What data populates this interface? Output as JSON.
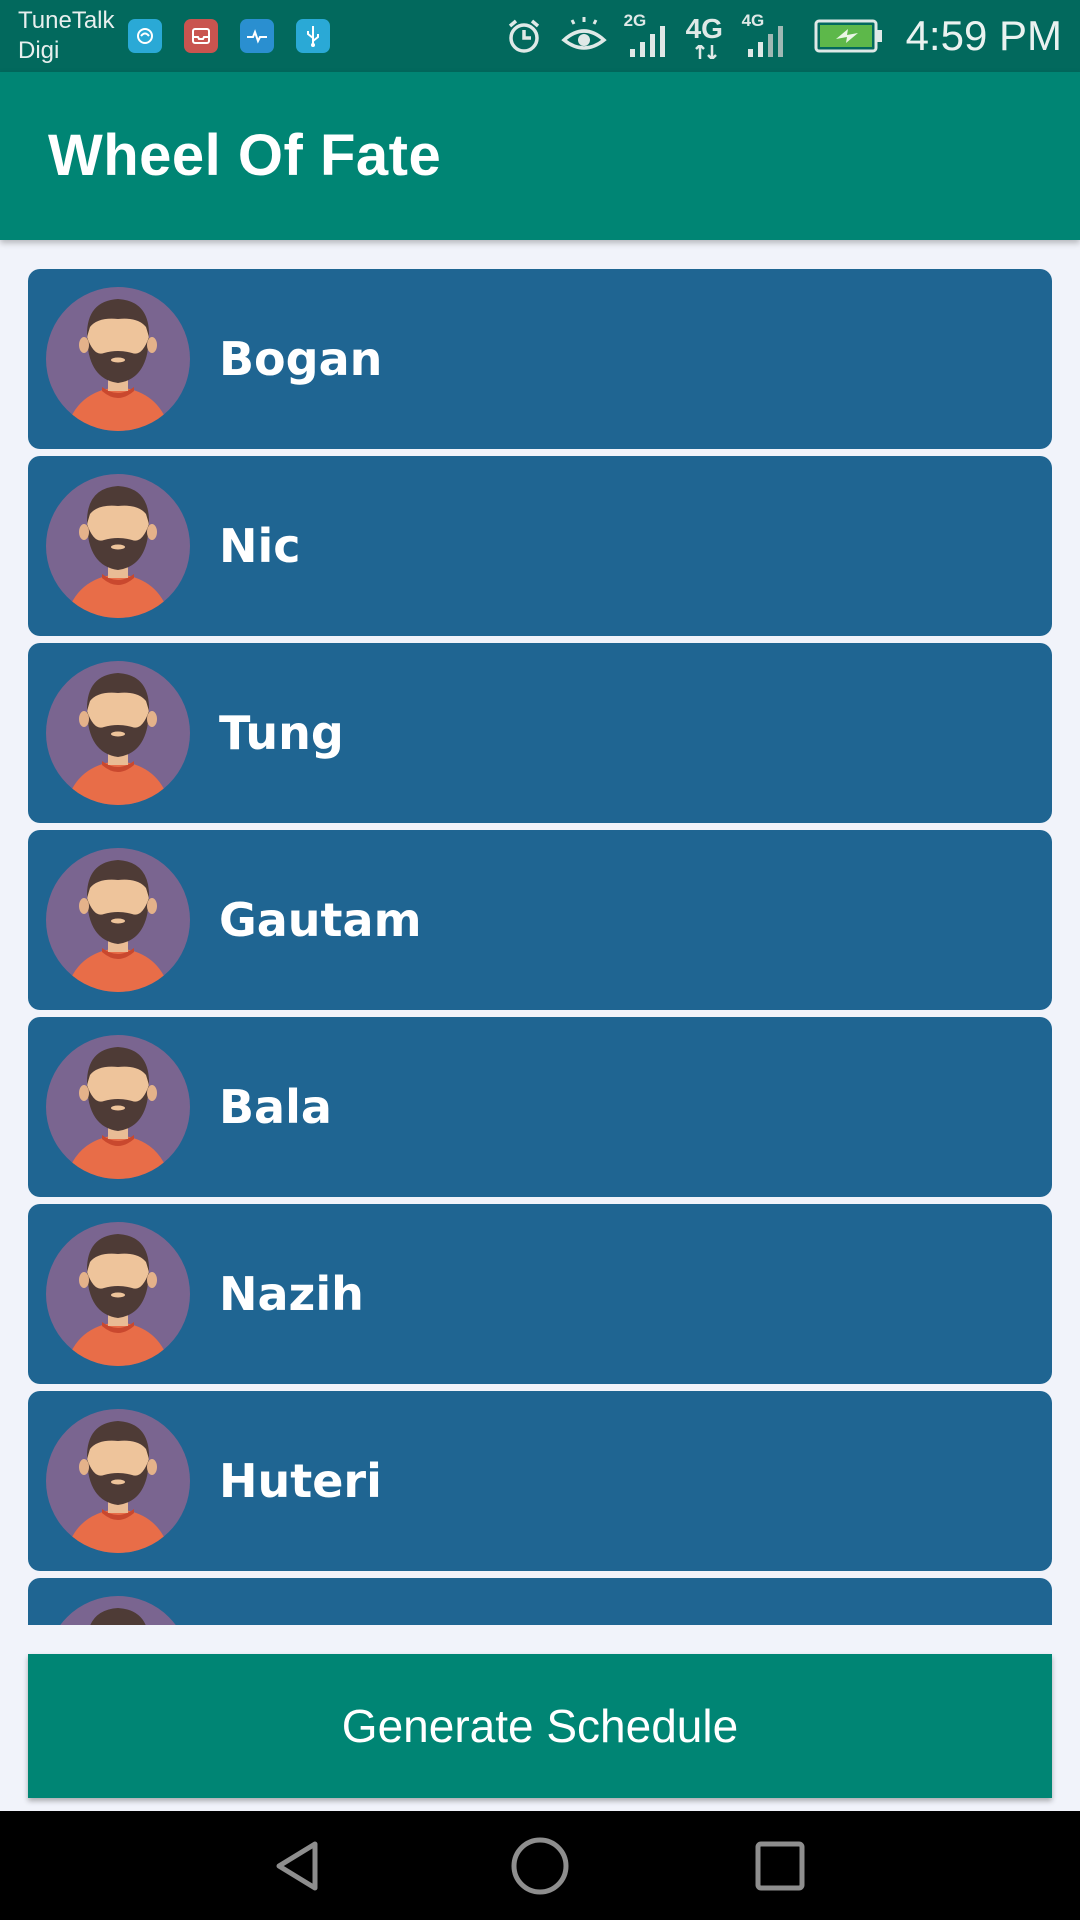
{
  "status_bar": {
    "carrier_line1": "TuneTalk",
    "carrier_line2": "Digi",
    "network_1": "2G",
    "network_2": "4G",
    "network_2_sub": "4G",
    "time": "4:59 PM",
    "notification_icons": [
      "sync-app-icon",
      "inbox-icon",
      "health-icon",
      "usb-icon"
    ],
    "system_icons": [
      "alarm-icon",
      "eye-comfort-icon",
      "signal-icon",
      "battery-charging-icon"
    ]
  },
  "app_bar": {
    "title": "Wheel Of Fate"
  },
  "engineers": [
    {
      "name": "Bogan"
    },
    {
      "name": "Nic"
    },
    {
      "name": "Tung"
    },
    {
      "name": "Gautam"
    },
    {
      "name": "Bala"
    },
    {
      "name": "Nazih"
    },
    {
      "name": "Huteri"
    },
    {
      "name": ""
    }
  ],
  "generate_button": {
    "label": "Generate Schedule"
  },
  "nav_bar": {
    "buttons": [
      "back-icon",
      "home-icon",
      "recents-icon"
    ]
  },
  "colors": {
    "primary": "#008574",
    "status_bar": "#02695d",
    "card": "#1f6592",
    "avatar_bg": "#7a6590",
    "background": "#f1f3fa"
  }
}
